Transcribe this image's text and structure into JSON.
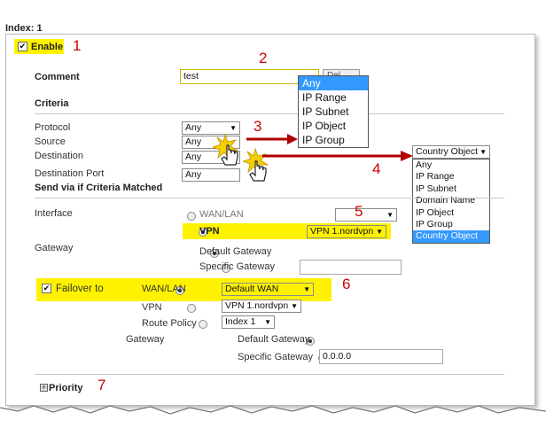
{
  "index_label": "Index: 1",
  "enable": {
    "label": "Enable",
    "number": "1"
  },
  "comment": {
    "label": "Comment",
    "value": "test",
    "number": "2",
    "button_partial": "Del"
  },
  "criteria": {
    "title": "Criteria",
    "protocol": {
      "label": "Protocol",
      "value": "Any"
    },
    "source": {
      "label": "Source",
      "value": "Any"
    },
    "destination": {
      "label": "Destination",
      "value": "Any"
    },
    "destination_port": {
      "label": "Destination Port",
      "value": "Any"
    },
    "number": "3"
  },
  "source_dropdown": {
    "options": [
      "Any",
      "IP Range",
      "IP Subnet",
      "IP Object",
      "IP Group"
    ],
    "selected": "Any"
  },
  "destination_dropdown": {
    "number": "4",
    "selected": "Country Object",
    "options": [
      "Any",
      "IP Range",
      "IP Subnet",
      "Domain Name",
      "IP Object",
      "IP Group",
      "Country Object"
    ]
  },
  "send_via": {
    "title": "Send via if Criteria Matched",
    "interface_label": "Interface",
    "wan_lan": "WAN/LAN",
    "vpn": "VPN",
    "vpn_value": "VPN 1.nordvpn",
    "number": "5",
    "gateway_label": "Gateway",
    "default_gateway": "Default Gateway",
    "specific_gateway": "Specific Gateway"
  },
  "failover": {
    "label": "Failover to",
    "number": "6",
    "wan_lan": "WAN/LAN",
    "wan_value": "Default WAN",
    "vpn": "VPN",
    "vpn_value": "VPN 1.nordvpn",
    "route_policy": "Route Policy",
    "route_value": "Index 1",
    "gateway_label": "Gateway",
    "default_gateway": "Default Gateway",
    "specific_gateway": "Specific Gateway",
    "specific_value": "0.0.0.0"
  },
  "priority": {
    "label": "Priority",
    "number": "7"
  },
  "colors": {
    "highlight": "#fff200",
    "annotation": "#cc0000",
    "selection": "#3399ff"
  }
}
